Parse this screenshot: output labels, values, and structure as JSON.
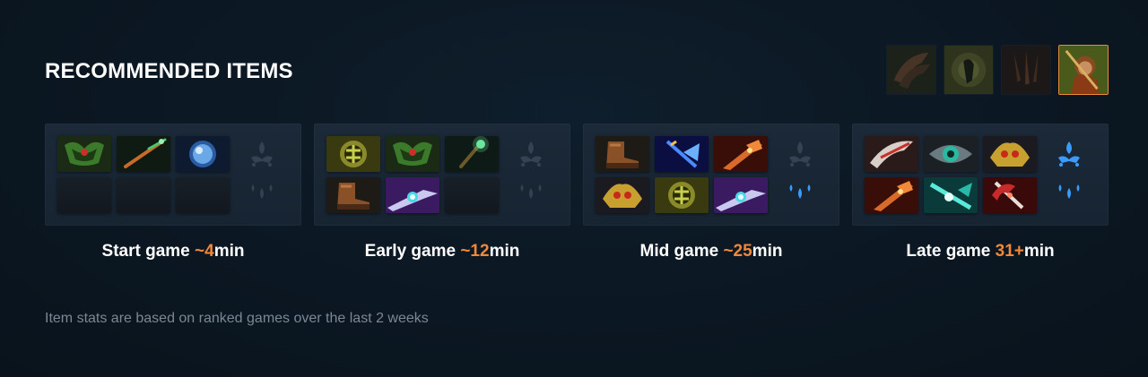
{
  "header": {
    "title": "RECOMMENDED ITEMS"
  },
  "hero_tabs": [
    {
      "icon": "facet-claw-icon",
      "active": false
    },
    {
      "icon": "facet-monkey-silhouette-icon",
      "active": false
    },
    {
      "icon": "facet-claw-dark-icon",
      "active": false
    },
    {
      "icon": "hero-monkey-king-icon",
      "active": true
    }
  ],
  "phases": [
    {
      "label": "Start game ",
      "time_value": "~4",
      "time_unit": "min",
      "items": [
        "wraith-band-icon",
        "faerie-fire-icon",
        "orb-icon",
        "empty",
        "empty",
        "empty"
      ],
      "neutral_tier": "dim"
    },
    {
      "label": "Early game ",
      "time_value": "~12",
      "time_unit": "min",
      "items": [
        "maelstrom-icon",
        "wraith-band-icon",
        "magic-wand-icon",
        "power-treads-icon",
        "diffusal-blade-icon",
        "empty"
      ],
      "neutral_tier": "dim"
    },
    {
      "label": "Mid game ",
      "time_value": "~25",
      "time_unit": "min",
      "items": [
        "power-treads-icon",
        "blue-scepter-icon",
        "desolator-icon",
        "sange-helm-icon",
        "maelstrom-icon",
        "diffusal-blade-icon"
      ],
      "neutral_tier": "half"
    },
    {
      "label": "Late game ",
      "time_value": "31+",
      "time_unit": "min",
      "items": [
        "battle-fury-icon",
        "eye-of-skadi-icon",
        "sange-helm-icon",
        "desolator-icon",
        "abyssal-blade-icon",
        "crimson-daedalus-icon"
      ],
      "neutral_tier": "full"
    }
  ],
  "footnote": "Item stats are based on ranked games over the last 2 weeks",
  "colors": {
    "accent": "#f0883a",
    "neutral_glow": "#3a9bff"
  }
}
